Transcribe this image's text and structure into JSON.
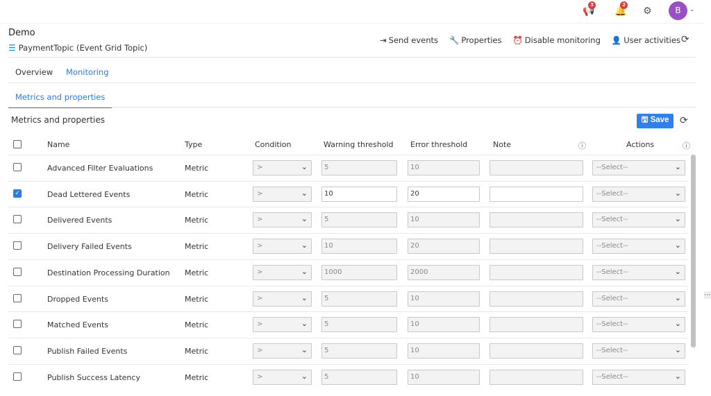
{
  "topbar": {
    "announcements_count": "3",
    "notifications_count": "2",
    "avatar_initial": "B"
  },
  "header": {
    "title": "Demo",
    "resource_name": "PaymentTopic",
    "resource_type": "(Event Grid Topic)"
  },
  "actions": {
    "send_events": "Send events",
    "properties": "Properties",
    "disable_monitoring": "Disable monitoring",
    "user_activities": "User activities"
  },
  "tabs": [
    {
      "label": "Overview"
    },
    {
      "label": "Monitoring"
    }
  ],
  "subtab": "Metrics and properties",
  "section_title": "Metrics and properties",
  "save_label": "Save",
  "columns": {
    "name": "Name",
    "type": "Type",
    "condition": "Condition",
    "warning": "Warning threshold",
    "error": "Error threshold",
    "note": "Note",
    "actions": "Actions"
  },
  "rows": [
    {
      "name": "Advanced Filter Evaluations",
      "type": "Metric",
      "condition": ">",
      "warning": "5",
      "error": "10",
      "note": "",
      "action": "--Select--",
      "checked": false
    },
    {
      "name": "Dead Lettered Events",
      "type": "Metric",
      "condition": ">",
      "warning": "10",
      "error": "20",
      "note": "",
      "action": "--Select--",
      "checked": true
    },
    {
      "name": "Delivered Events",
      "type": "Metric",
      "condition": ">",
      "warning": "5",
      "error": "10",
      "note": "",
      "action": "--Select--",
      "checked": false
    },
    {
      "name": "Delivery Failed Events",
      "type": "Metric",
      "condition": ">",
      "warning": "10",
      "error": "20",
      "note": "",
      "action": "--Select--",
      "checked": false
    },
    {
      "name": "Destination Processing Duration",
      "type": "Metric",
      "condition": ">",
      "warning": "1000",
      "error": "2000",
      "note": "",
      "action": "--Select--",
      "checked": false
    },
    {
      "name": "Dropped Events",
      "type": "Metric",
      "condition": ">",
      "warning": "5",
      "error": "10",
      "note": "",
      "action": "--Select--",
      "checked": false
    },
    {
      "name": "Matched Events",
      "type": "Metric",
      "condition": ">",
      "warning": "5",
      "error": "10",
      "note": "",
      "action": "--Select--",
      "checked": false
    },
    {
      "name": "Publish Failed Events",
      "type": "Metric",
      "condition": ">",
      "warning": "5",
      "error": "10",
      "note": "",
      "action": "--Select--",
      "checked": false
    },
    {
      "name": "Publish Success Latency",
      "type": "Metric",
      "condition": ">",
      "warning": "5",
      "error": "10",
      "note": "",
      "action": "--Select--",
      "checked": false
    }
  ]
}
